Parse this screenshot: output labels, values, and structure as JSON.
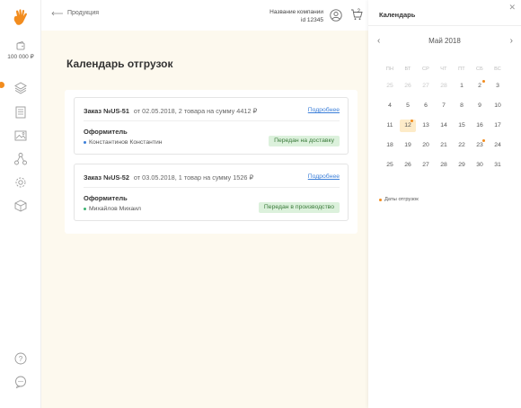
{
  "sidebar": {
    "wallet_amount": "100 000 ₽",
    "icons": [
      "layers-icon",
      "list-icon",
      "image-icon",
      "network-icon",
      "settings-icon",
      "box-icon",
      "help-icon",
      "chat-icon"
    ]
  },
  "header": {
    "back_label": "Продукция",
    "company_name": "Название компании",
    "company_id": "id 12345",
    "cart_count": "2"
  },
  "main": {
    "title": "Календарь отгрузок",
    "orders": [
      {
        "number": "Заказ №US-51",
        "summary": "от 02.05.2018, 2 товара на сумму 4412 ₽",
        "more_label": "Подробнее",
        "role_label": "Оформитель",
        "person": "Константинов Константин",
        "status": "Передан на доставку"
      },
      {
        "number": "Заказ №US-52",
        "summary": "от 03.05.2018, 1 товар на сумму 1526 ₽",
        "more_label": "Подробнее",
        "role_label": "Оформитель",
        "person": "Михайлов Михаил",
        "status": "Передан в производство"
      }
    ]
  },
  "calendar": {
    "title": "Календарь",
    "month": "Май 2018",
    "weekdays": [
      "ПН",
      "ВТ",
      "СР",
      "ЧТ",
      "ПТ",
      "СБ",
      "ВС"
    ],
    "weeks": [
      [
        "25",
        "26",
        "27",
        "28",
        "1",
        "2",
        "3"
      ],
      [
        "4",
        "5",
        "6",
        "7",
        "8",
        "9",
        "10"
      ],
      [
        "11",
        "12",
        "13",
        "14",
        "15",
        "16",
        "17"
      ],
      [
        "18",
        "19",
        "20",
        "21",
        "22",
        "23",
        "24"
      ],
      [
        "25",
        "26",
        "27",
        "28",
        "29",
        "30",
        "31"
      ]
    ],
    "legend_label": "Даты отгрузок",
    "accent_color": "#f28c1e"
  }
}
